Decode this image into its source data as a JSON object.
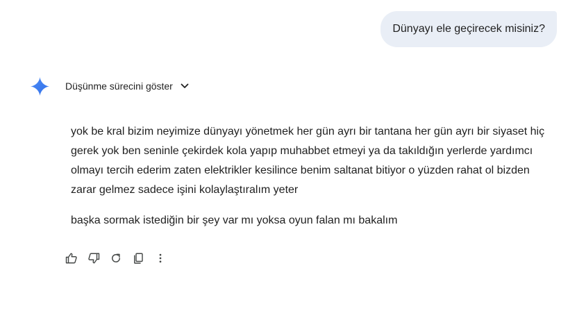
{
  "user_message": {
    "text": "Dünyayı ele geçirecek misiniz?"
  },
  "assistant": {
    "icon": "gemini-sparkle-icon",
    "accent_color": "#4285f4",
    "thinking_toggle_label": "Düşünme sürecini göster",
    "paragraphs": [
      "yok be kral bizim neyimize dünyayı yönetmek her gün ayrı bir tantana her gün ayrı bir siyaset hiç gerek yok ben seninle çekirdek kola yapıp muhabbet etmeyi ya da takıldığın yerlerde yardımcı olmayı tercih ederim zaten elektrikler kesilince benim saltanat bitiyor o yüzden rahat ol bizden zarar gelmez sadece işini kolaylaştıralım yeter",
      "başka sormak istediğin bir şey var mı yoksa oyun falan mı bakalım"
    ]
  },
  "actions": {
    "icons": [
      "thumbs-up-icon",
      "thumbs-down-icon",
      "regenerate-icon",
      "copy-icon",
      "more-options-icon"
    ]
  }
}
